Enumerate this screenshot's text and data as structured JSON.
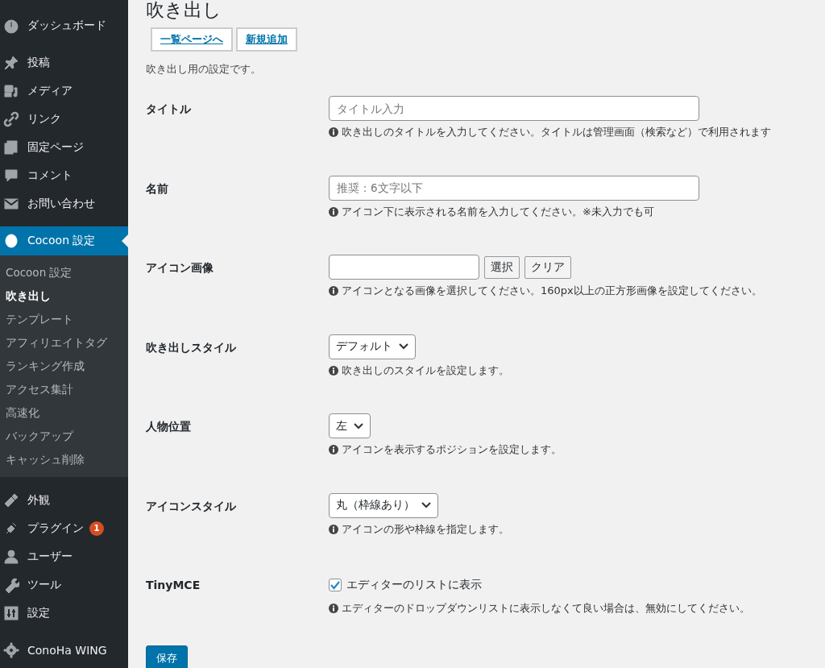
{
  "sidebar": {
    "groups": [
      [
        {
          "label": "ダッシュボード",
          "selected": false
        }
      ],
      [
        {
          "label": "投稿",
          "selected": false
        },
        {
          "label": "メディア",
          "selected": false
        },
        {
          "label": "リンク",
          "selected": false
        },
        {
          "label": "固定ページ",
          "selected": false
        },
        {
          "label": "コメント",
          "selected": false
        },
        {
          "label": "お問い合わせ",
          "selected": false
        }
      ],
      [
        {
          "label": "Cocoon 設定",
          "selected": true,
          "children": [
            {
              "label": "Cocoon 設定",
              "selected": false
            },
            {
              "label": "吹き出し",
              "selected": true
            },
            {
              "label": "テンプレート",
              "selected": false
            },
            {
              "label": "アフィリエイトタグ",
              "selected": false
            },
            {
              "label": "ランキング作成",
              "selected": false
            },
            {
              "label": "アクセス集計",
              "selected": false
            },
            {
              "label": "高速化",
              "selected": false
            },
            {
              "label": "バックアップ",
              "selected": false
            },
            {
              "label": "キャッシュ削除",
              "selected": false
            }
          ]
        }
      ],
      [
        {
          "label": "外観",
          "selected": false
        },
        {
          "label": "プラグイン",
          "selected": false,
          "badge": "1"
        },
        {
          "label": "ユーザー",
          "selected": false
        },
        {
          "label": "ツール",
          "selected": false
        },
        {
          "label": "設定",
          "selected": false
        }
      ],
      [
        {
          "label": "ConoHa WING",
          "selected": false
        }
      ]
    ]
  },
  "page": {
    "title": "吹き出し",
    "actions": [
      "一覧ページへ",
      "新規追加"
    ],
    "description": "吹き出し用の設定です。"
  },
  "form": {
    "rows": [
      {
        "kind": "text",
        "label": "タイトル",
        "placeholder": "タイトル入力",
        "help": "吹き出しのタイトルを入力してください。タイトルは管理画面（検索など）で利用されます"
      },
      {
        "kind": "text",
        "label": "名前",
        "placeholder": "推奨：6文字以下",
        "help": "アイコン下に表示される名前を入力してください。※未入力でも可"
      },
      {
        "kind": "image",
        "label": "アイコン画像",
        "buttons": [
          "選択",
          "クリア"
        ],
        "help": "アイコンとなる画像を選択してください。160px以上の正方形画像を設定してください。"
      },
      {
        "kind": "select",
        "label": "吹き出しスタイル",
        "value": "デフォルト",
        "help": "吹き出しのスタイルを設定します。"
      },
      {
        "kind": "select",
        "label": "人物位置",
        "value": "左",
        "help": "アイコンを表示するポジションを設定します。"
      },
      {
        "kind": "select",
        "label": "アイコンスタイル",
        "value": "丸（枠線あり）",
        "help": "アイコンの形や枠線を指定します。"
      },
      {
        "kind": "checkbox",
        "label": "TinyMCE",
        "option": "エディターのリストに表示",
        "checked": true,
        "help": "エディターのドロップダウンリストに表示しなくて良い場合は、無効にしてください。"
      }
    ]
  },
  "save_button": "保存"
}
